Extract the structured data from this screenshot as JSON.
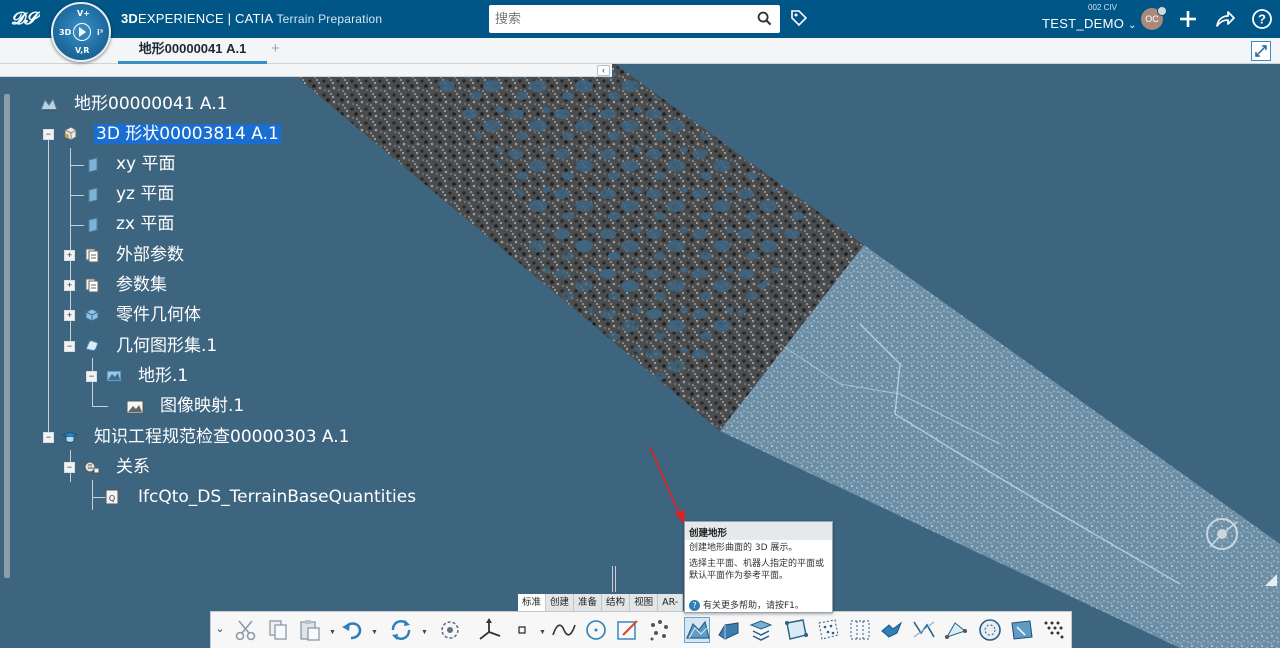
{
  "header": {
    "brand_bold": "3D",
    "brand_rest": "EXPERIENCE | CATIA ",
    "app_name": "Terrain Preparation",
    "search_placeholder": "搜索",
    "tenant": "002 CIV",
    "user_name": "TEST_DEMO",
    "avatar_initials": "OC",
    "compass_labels": {
      "top": "V+",
      "left": "3D",
      "right": "i³",
      "bottom": "V,R"
    }
  },
  "tabs": [
    {
      "label": "地形00000041 A.1",
      "active": true
    }
  ],
  "tab_add": "+",
  "collapse_glyph": "‹",
  "tree": [
    {
      "label": "地形00000041 A.1",
      "icon": "terrain-root-icon",
      "selected": false
    },
    {
      "label": "3D 形状00003814 A.1",
      "icon": "3d-shape-icon",
      "selected": true,
      "toggle": "−"
    },
    {
      "label": "xy 平面",
      "icon": "plane-icon"
    },
    {
      "label": "yz 平面",
      "icon": "plane-icon"
    },
    {
      "label": "zx 平面",
      "icon": "plane-icon"
    },
    {
      "label": "外部参数",
      "icon": "parameters-icon",
      "toggle": "+"
    },
    {
      "label": "参数集",
      "icon": "parameter-set-icon",
      "toggle": "+"
    },
    {
      "label": "零件几何体",
      "icon": "part-body-icon",
      "toggle": "+"
    },
    {
      "label": "几何图形集.1",
      "icon": "geometrical-set-icon",
      "toggle": "−"
    },
    {
      "label": "地形.1",
      "icon": "terrain-feature-icon",
      "toggle": "−"
    },
    {
      "label": "图像映射.1",
      "icon": "image-mapping-icon"
    },
    {
      "label": "知识工程规范检查00000303 A.1",
      "icon": "knowledge-check-icon",
      "toggle": "−"
    },
    {
      "label": "关系",
      "icon": "relations-icon",
      "toggle": "−"
    },
    {
      "label": "IfcQto_DS_TerrainBaseQuantities",
      "icon": "ifc-quantities-icon"
    }
  ],
  "tooltip": {
    "title": "创建地形",
    "line1": "创建地形曲面的 3D 展示。",
    "line2": "选择主平面、机器人指定的平面或默认平面作为参考平面。",
    "help": "有关更多帮助，请按F1。",
    "help_glyph": "?"
  },
  "section_tabs": [
    "标准",
    "创建",
    "准备",
    "结构",
    "视图",
    "AR-"
  ],
  "active_section": "标准",
  "colors": {
    "topbar": "#005686",
    "viewport_bg": "#3e6580",
    "selection": "#1a6dd1",
    "annotation_arrow": "#e02020"
  },
  "toolbar_icons": [
    "cut-icon",
    "copy-icon",
    "paste-icon",
    "undo-icon",
    "update-icon",
    "image-settings-icon",
    "axis-system-icon",
    "point-icon",
    "spline-icon",
    "circle-icon",
    "sketch-icon",
    "point-cloud-icon",
    "create-terrain-icon",
    "terrain-solid-icon",
    "terrain-trim-icon",
    "terrain-boundary-icon",
    "terrain-sample-icon",
    "terrain-grid-icon",
    "bird-icon",
    "terrain-compare-icon",
    "terrain-measure-icon",
    "disc-icon",
    "terrain-project-icon",
    "terrain-points-icon"
  ]
}
